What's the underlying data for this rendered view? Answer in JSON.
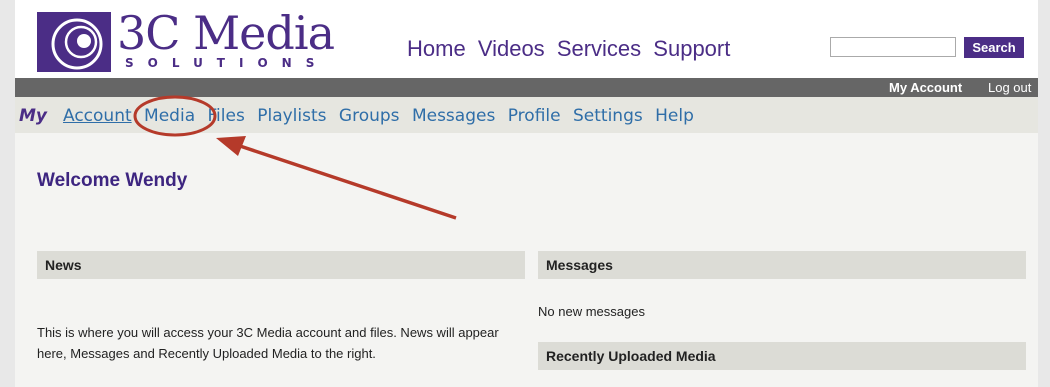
{
  "header": {
    "logo_word": "3C Media",
    "logo_sub": "SOLUTIONS",
    "nav": [
      "Home",
      "Videos",
      "Services",
      "Support"
    ],
    "search_button": "Search",
    "search_placeholder": ""
  },
  "account_bar": {
    "my_account": "My Account",
    "log_out": "Log out"
  },
  "subnav": {
    "prefix": "My",
    "items": [
      "Account",
      "Media",
      "Files",
      "Playlists",
      "Groups",
      "Messages",
      "Profile",
      "Settings",
      "Help"
    ],
    "active": "Account"
  },
  "main": {
    "welcome": "Welcome Wendy",
    "news": {
      "heading": "News",
      "text": "This is where you will access your 3C Media account and files. News will appear here, Messages and Recently Uploaded Media to the right."
    },
    "messages": {
      "heading": "Messages",
      "text": "No new messages"
    },
    "recent": {
      "heading": "Recently Uploaded Media"
    }
  },
  "colors": {
    "brand": "#4b2d86",
    "link": "#2f6ea8",
    "annotation": "#b53a2a"
  }
}
